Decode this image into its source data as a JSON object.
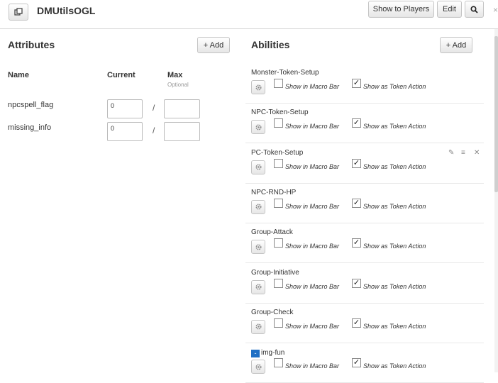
{
  "header": {
    "title": "DMUtilsOGL",
    "show_to_players_label": "Show to Players",
    "edit_label": "Edit",
    "search_icon": "search-icon",
    "popout_icon": "popout-icon",
    "close_glyph": "×"
  },
  "attributes": {
    "title": "Attributes",
    "add_label": "+ Add",
    "columns": {
      "name": "Name",
      "current": "Current",
      "max": "Max",
      "max_hint": "Optional"
    },
    "rows": [
      {
        "name": "npcspell_flag",
        "current": "0",
        "max": "",
        "separator": "/"
      },
      {
        "name": "missing_info",
        "current": "0",
        "max": "",
        "separator": "/"
      }
    ]
  },
  "abilities": {
    "title": "Abilities",
    "add_label": "+ Add",
    "macro_bar_label": "Show in Macro Bar",
    "token_action_label": "Show as Token Action",
    "items": [
      {
        "name": "Monster-Token-Setup",
        "macro_bar": false,
        "token_action": true
      },
      {
        "name": "NPC-Token-Setup",
        "macro_bar": false,
        "token_action": true
      },
      {
        "name": "PC-Token-Setup",
        "macro_bar": false,
        "token_action": true,
        "hover_tools": [
          "edit-icon",
          "reorder-icon",
          "delete-icon"
        ]
      },
      {
        "name": "NPC-RND-HP",
        "macro_bar": false,
        "token_action": true
      },
      {
        "name": "Group-Attack",
        "macro_bar": false,
        "token_action": true
      },
      {
        "name": "Group-Initiative",
        "macro_bar": false,
        "token_action": true
      },
      {
        "name": "Group-Check",
        "macro_bar": false,
        "token_action": true
      },
      {
        "name": "img-fun",
        "macro_bar": false,
        "token_action": true,
        "selected": true
      }
    ]
  },
  "colors": {
    "selection": "#1e6fc4",
    "border": "#c4c4c4"
  }
}
